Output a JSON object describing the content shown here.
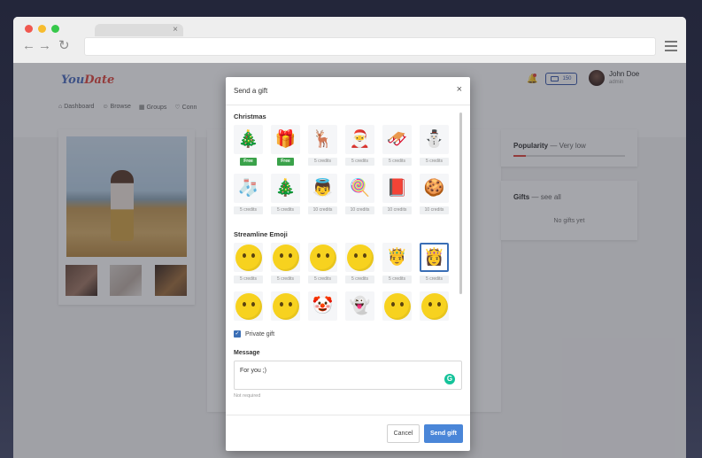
{
  "browser": {
    "tab_close": "×"
  },
  "app": {
    "logo_left": "You",
    "logo_right": "Date",
    "credits": "150",
    "user_name": "John Doe",
    "user_role": "admin",
    "nav": [
      "Dashboard",
      "Browse",
      "Groups",
      "Conn"
    ]
  },
  "profile": {
    "popularity_label": "Popularity",
    "popularity_value": "— Very low",
    "popularity_level": 0.11,
    "gifts_label": "Gifts",
    "gifts_link": "— see all",
    "gifts_empty": "No gifts yet"
  },
  "modal": {
    "title": "Send a gift",
    "close": "×",
    "sections": [
      {
        "title": "Christmas",
        "items": [
          {
            "icon": "ornament-icon",
            "glyph": "🎄",
            "price": "Free",
            "free": true
          },
          {
            "icon": "present-icon",
            "glyph": "🎁",
            "price": "Free",
            "free": true
          },
          {
            "icon": "reindeer-icon",
            "glyph": "🦌",
            "price": "5 credits"
          },
          {
            "icon": "santa-icon",
            "glyph": "🎅",
            "price": "5 credits"
          },
          {
            "icon": "sleigh-icon",
            "glyph": "🛷",
            "price": "5 credits"
          },
          {
            "icon": "snowman-icon",
            "glyph": "⛄",
            "price": "5 credits"
          },
          {
            "icon": "stocking-icon",
            "glyph": "🧦",
            "price": "5 credits"
          },
          {
            "icon": "snow-globe-icon",
            "glyph": "🎄",
            "price": "5 credits"
          },
          {
            "icon": "angel-icon",
            "glyph": "👼",
            "price": "10 credits"
          },
          {
            "icon": "candy-cane-icon",
            "glyph": "🍭",
            "price": "10 credits"
          },
          {
            "icon": "card-icon",
            "glyph": "📕",
            "price": "10 credits"
          },
          {
            "icon": "gingerbread-icon",
            "glyph": "🍪",
            "price": "10 credits"
          }
        ]
      },
      {
        "title": "Streamline Emoji",
        "items": [
          {
            "icon": "grinning-face-icon",
            "price": "5 credits"
          },
          {
            "icon": "drooling-face-icon",
            "price": "5 credits"
          },
          {
            "icon": "tongue-face-icon",
            "price": "5 credits"
          },
          {
            "icon": "nerd-face-icon",
            "price": "5 credits"
          },
          {
            "icon": "king-icon",
            "glyph": "🤴",
            "price": "5 credits"
          },
          {
            "icon": "queen-icon",
            "glyph": "👸",
            "price": "5 credits",
            "selected": true
          },
          {
            "icon": "sleepy-face-icon"
          },
          {
            "icon": "giggling-face-icon"
          },
          {
            "icon": "clown-icon",
            "glyph": "🤡"
          },
          {
            "icon": "ghost-icon",
            "glyph": "👻"
          },
          {
            "icon": "kiss-face-icon"
          },
          {
            "icon": "heart-eyes-icon"
          }
        ]
      }
    ],
    "private_label": "Private gift",
    "private_checked": true,
    "message_label": "Message",
    "message_value": "For you ;)",
    "message_help": "Not required",
    "cancel_label": "Cancel",
    "send_label": "Send gift"
  }
}
